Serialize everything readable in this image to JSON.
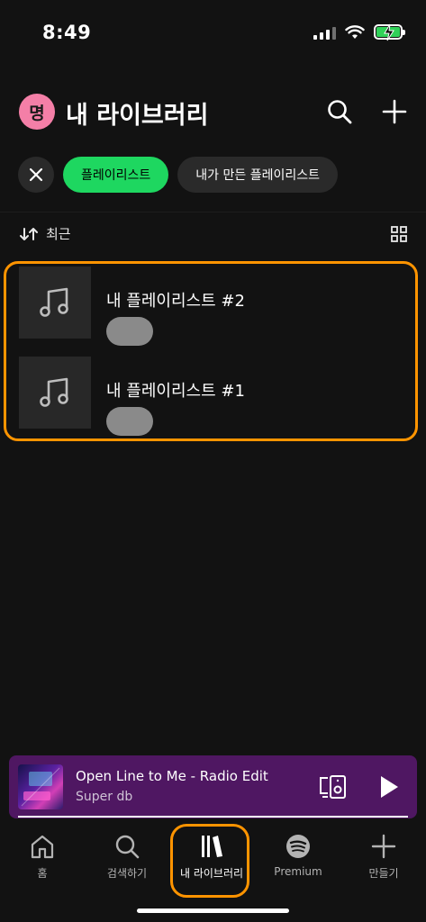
{
  "status_bar": {
    "time": "8:49"
  },
  "header": {
    "avatar_letter": "명",
    "title": "내 라이브러리"
  },
  "filters": {
    "active_label": "플레이리스트",
    "other_label": "내가 만든 플레이리스트"
  },
  "sort": {
    "label": "최근"
  },
  "playlists": [
    {
      "title": "내 플레이리스트 #2"
    },
    {
      "title": "내 플레이리스트 #1"
    }
  ],
  "player": {
    "title": "Open Line to Me - Radio Edit",
    "artist": "Super db",
    "progress": 1.0
  },
  "nav": {
    "items": [
      {
        "label": "홈",
        "icon": "home-icon"
      },
      {
        "label": "검색하기",
        "icon": "search-icon"
      },
      {
        "label": "내 라이브러리",
        "icon": "library-icon"
      },
      {
        "label": "Premium",
        "icon": "spotify-icon"
      },
      {
        "label": "만들기",
        "icon": "plus-icon"
      }
    ],
    "active_index": 2
  },
  "colors": {
    "accent": "#1ed760",
    "highlight": "#ff9400",
    "player_bg": "#4f1762"
  }
}
